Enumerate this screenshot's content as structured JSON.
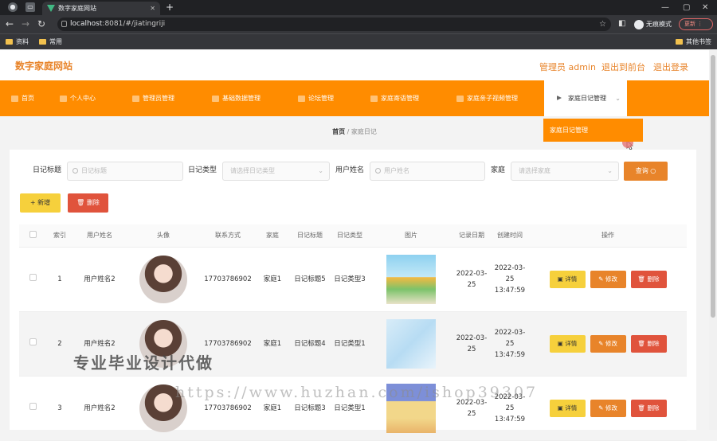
{
  "browser": {
    "tab_title": "数字家庭网站",
    "url_host": "localhost",
    "url_rest": ":8081/#/jiatingriji",
    "incognito_label": "无痕模式",
    "update_label": "更新",
    "bookmarks": [
      "资料",
      "常用"
    ],
    "other_bookmarks": "其他书签"
  },
  "header": {
    "site_title": "数字家庭网站",
    "user_label": "管理员 admin",
    "back_label": "退出到前台",
    "logout_label": "退出登录"
  },
  "menu": {
    "items": [
      "首页",
      "个人中心",
      "管理员管理",
      "基础数据管理",
      "论坛管理",
      "家庭寄语管理",
      "家庭亲子视频管理",
      "家庭日记管理"
    ],
    "submenu_item": "家庭日记管理"
  },
  "breadcrumb": {
    "home": "首页",
    "sep": "/",
    "current": "家庭日记"
  },
  "search": {
    "title_label": "日记标题",
    "title_placeholder": "日记标题",
    "type_label": "日记类型",
    "type_placeholder": "请选择日记类型",
    "user_label": "用户姓名",
    "user_placeholder": "用户姓名",
    "family_label": "家庭",
    "family_placeholder": "请选择家庭",
    "query_label": "查询"
  },
  "actions": {
    "add_label": "+ 新增",
    "delete_label": "删除"
  },
  "table": {
    "columns": [
      "索引",
      "用户姓名",
      "头像",
      "联系方式",
      "家庭",
      "日记标题",
      "日记类型",
      "图片",
      "记录日期",
      "创建时间",
      "操作"
    ],
    "action_labels": {
      "detail": "详情",
      "modify": "修改",
      "delete": "删除"
    },
    "rows": [
      {
        "index": "1",
        "user": "用户姓名2",
        "phone": "17703786902",
        "family": "家庭1",
        "title": "日记标题5",
        "type": "日记类型3",
        "date": "2022-03-25",
        "created": "2022-03-25 13:47:59"
      },
      {
        "index": "2",
        "user": "用户姓名2",
        "phone": "17703786902",
        "family": "家庭1",
        "title": "日记标题4",
        "type": "日记类型1",
        "date": "2022-03-25",
        "created": "2022-03-25 13:47:59"
      },
      {
        "index": "3",
        "user": "用户姓名2",
        "phone": "17703786902",
        "family": "家庭1",
        "title": "日记标题3",
        "type": "日记类型1",
        "date": "2022-03-25",
        "created": "2022-03-25 13:47:59"
      }
    ]
  },
  "watermark": {
    "line1": "专业毕业设计代做",
    "line2": "https://www.huzhan.com/ishop39307"
  },
  "colors": {
    "accent": "#ff8c00",
    "title": "#e8842a",
    "add": "#f6d03c",
    "danger": "#e0533c"
  }
}
